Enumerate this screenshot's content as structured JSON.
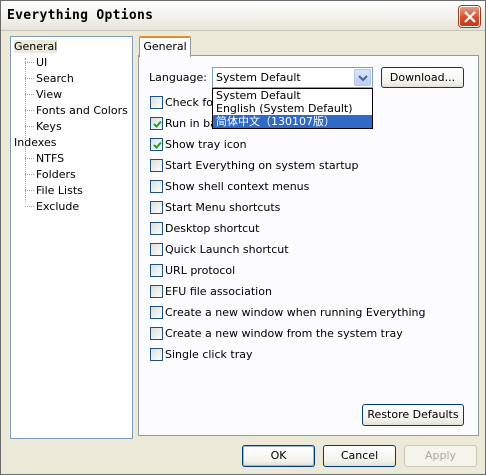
{
  "window": {
    "title": "Everything Options"
  },
  "tree": {
    "items": [
      {
        "label": "General",
        "selected": true
      },
      {
        "label": "UI"
      },
      {
        "label": "Search"
      },
      {
        "label": "View"
      },
      {
        "label": "Fonts and Colors"
      },
      {
        "label": "Keys"
      },
      {
        "label": "Indexes"
      },
      {
        "label": "NTFS"
      },
      {
        "label": "Folders"
      },
      {
        "label": "File Lists"
      },
      {
        "label": "Exclude"
      }
    ]
  },
  "tab": {
    "label": "General"
  },
  "language": {
    "label": "Language:",
    "value": "System Default",
    "options": [
      {
        "label": "System Default",
        "highlighted": false
      },
      {
        "label": "English (System Default)",
        "highlighted": false
      },
      {
        "label": "简体中文（130107版）",
        "highlighted": true
      }
    ]
  },
  "download_button": "Download...",
  "checkboxes": [
    {
      "label": "Check for updates on startup",
      "checked": false
    },
    {
      "label": "Run in background",
      "checked": true
    },
    {
      "label": "Show tray icon",
      "checked": true
    },
    {
      "label": "Start Everything on system startup",
      "checked": false
    },
    {
      "label": "Show shell context menus",
      "checked": false
    },
    {
      "label": "Start Menu shortcuts",
      "checked": false
    },
    {
      "label": "Desktop shortcut",
      "checked": false
    },
    {
      "label": "Quick Launch shortcut",
      "checked": false
    },
    {
      "label": "URL protocol",
      "checked": false
    },
    {
      "label": "EFU file association",
      "checked": false
    },
    {
      "label": "Create a new window when running Everything",
      "checked": false
    },
    {
      "label": "Create a new window from the system tray",
      "checked": false
    },
    {
      "label": "Single click tray",
      "checked": false
    }
  ],
  "restore_button": "Restore Defaults",
  "buttons": {
    "ok": "OK",
    "cancel": "Cancel",
    "apply": "Apply"
  },
  "colors": {
    "accent": "#316ac5",
    "tab_highlight": "#e68b2c",
    "close": "#d4512e"
  }
}
